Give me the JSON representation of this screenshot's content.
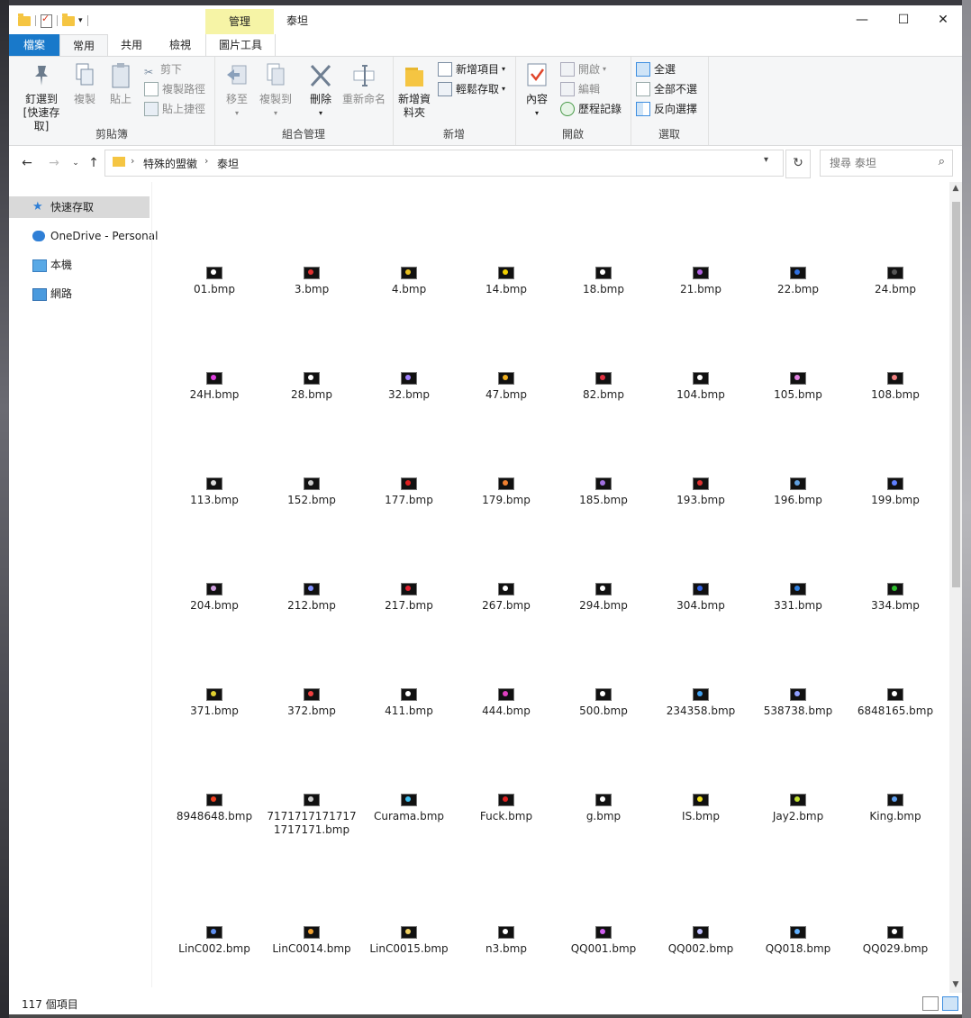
{
  "window": {
    "title": "泰坦",
    "context_tab_header": "管理",
    "minimize": "—",
    "maximize": "☐",
    "close": "✕"
  },
  "tabs": {
    "file": "檔案",
    "home": "常用",
    "share": "共用",
    "view": "檢視",
    "picture_tools": "圖片工具"
  },
  "ribbon": {
    "clipboard": {
      "label": "剪貼簿",
      "pin": "釘選到 [快速存取]",
      "copy": "複製",
      "paste": "貼上",
      "cut": "剪下",
      "copy_path": "複製路徑",
      "paste_shortcut": "貼上捷徑"
    },
    "organize": {
      "label": "組合管理",
      "move_to": "移至",
      "copy_to": "複製到",
      "delete": "刪除",
      "rename": "重新命名"
    },
    "new": {
      "label": "新增",
      "new_folder": "新增資料夾",
      "new_item": "新增項目",
      "easy_access": "輕鬆存取"
    },
    "open": {
      "label": "開啟",
      "properties": "內容",
      "open": "開啟",
      "edit": "編輯",
      "history": "歷程記錄"
    },
    "select": {
      "label": "選取",
      "select_all": "全選",
      "select_none": "全部不選",
      "invert": "反向選擇"
    }
  },
  "address": {
    "crumbs": [
      "特殊的盟徽",
      "泰坦"
    ],
    "search_placeholder": "搜尋 泰坦"
  },
  "nav": {
    "items": [
      {
        "label": "快速存取",
        "icon": "star-icon"
      },
      {
        "label": "OneDrive - Personal",
        "icon": "cloud-icon"
      },
      {
        "label": "本機",
        "icon": "computer-icon"
      },
      {
        "label": "網路",
        "icon": "network-icon"
      }
    ]
  },
  "files": [
    {
      "name": "01.bmp",
      "color": "#ffffff"
    },
    {
      "name": "3.bmp",
      "color": "#e03030"
    },
    {
      "name": "4.bmp",
      "color": "#e8c020"
    },
    {
      "name": "14.bmp",
      "color": "#f0d000"
    },
    {
      "name": "18.bmp",
      "color": "#ffffff"
    },
    {
      "name": "21.bmp",
      "color": "#b060e0"
    },
    {
      "name": "22.bmp",
      "color": "#3070e0"
    },
    {
      "name": "24.bmp",
      "color": "#555555"
    },
    {
      "name": "24H.bmp",
      "color": "#e040e0"
    },
    {
      "name": "28.bmp",
      "color": "#ffffff"
    },
    {
      "name": "32.bmp",
      "color": "#a080ff"
    },
    {
      "name": "47.bmp",
      "color": "#f0b020"
    },
    {
      "name": "82.bmp",
      "color": "#e03040"
    },
    {
      "name": "104.bmp",
      "color": "#ffffff"
    },
    {
      "name": "105.bmp",
      "color": "#e080e0"
    },
    {
      "name": "108.bmp",
      "color": "#f08080"
    },
    {
      "name": "113.bmp",
      "color": "#dddddd"
    },
    {
      "name": "152.bmp",
      "color": "#cccccc"
    },
    {
      "name": "177.bmp",
      "color": "#e02020"
    },
    {
      "name": "179.bmp",
      "color": "#f08030"
    },
    {
      "name": "185.bmp",
      "color": "#a070e0"
    },
    {
      "name": "193.bmp",
      "color": "#e03030"
    },
    {
      "name": "196.bmp",
      "color": "#60a0e0"
    },
    {
      "name": "199.bmp",
      "color": "#6080ff"
    },
    {
      "name": "204.bmp",
      "color": "#d0a0e0"
    },
    {
      "name": "212.bmp",
      "color": "#8090ff"
    },
    {
      "name": "217.bmp",
      "color": "#e02030"
    },
    {
      "name": "267.bmp",
      "color": "#ffffff"
    },
    {
      "name": "294.bmp",
      "color": "#ffffff"
    },
    {
      "name": "304.bmp",
      "color": "#3060e0"
    },
    {
      "name": "331.bmp",
      "color": "#3080e0"
    },
    {
      "name": "334.bmp",
      "color": "#30c030"
    },
    {
      "name": "371.bmp",
      "color": "#e0d030"
    },
    {
      "name": "372.bmp",
      "color": "#f04040"
    },
    {
      "name": "411.bmp",
      "color": "#ffffff"
    },
    {
      "name": "444.bmp",
      "color": "#e040c0"
    },
    {
      "name": "500.bmp",
      "color": "#ffffff"
    },
    {
      "name": "234358.bmp",
      "color": "#40a0f0"
    },
    {
      "name": "538738.bmp",
      "color": "#90a0ff"
    },
    {
      "name": "6848165.bmp",
      "color": "#ffffff"
    },
    {
      "name": "8948648.bmp",
      "color": "#f04020"
    },
    {
      "name": "71717171717171717171.bmp",
      "color": "#cccccc"
    },
    {
      "name": "Curama.bmp",
      "color": "#40c0f0"
    },
    {
      "name": "Fuck.bmp",
      "color": "#e02020"
    },
    {
      "name": "g.bmp",
      "color": "#ffffff"
    },
    {
      "name": "IS.bmp",
      "color": "#f0e020"
    },
    {
      "name": "Jay2.bmp",
      "color": "#c0e030"
    },
    {
      "name": "King.bmp",
      "color": "#60a0f0"
    },
    {
      "name": "LinC002.bmp",
      "color": "#6090f0"
    },
    {
      "name": "LinC0014.bmp",
      "color": "#f0a030"
    },
    {
      "name": "LinC0015.bmp",
      "color": "#f0d060"
    },
    {
      "name": "n3.bmp",
      "color": "#ffffff"
    },
    {
      "name": "QQ001.bmp",
      "color": "#d060f0"
    },
    {
      "name": "QQ002.bmp",
      "color": "#c0c0ff"
    },
    {
      "name": "QQ018.bmp",
      "color": "#60b0ff"
    },
    {
      "name": "QQ029.bmp",
      "color": "#ffffff"
    }
  ],
  "status": {
    "count": "117 個項目"
  }
}
